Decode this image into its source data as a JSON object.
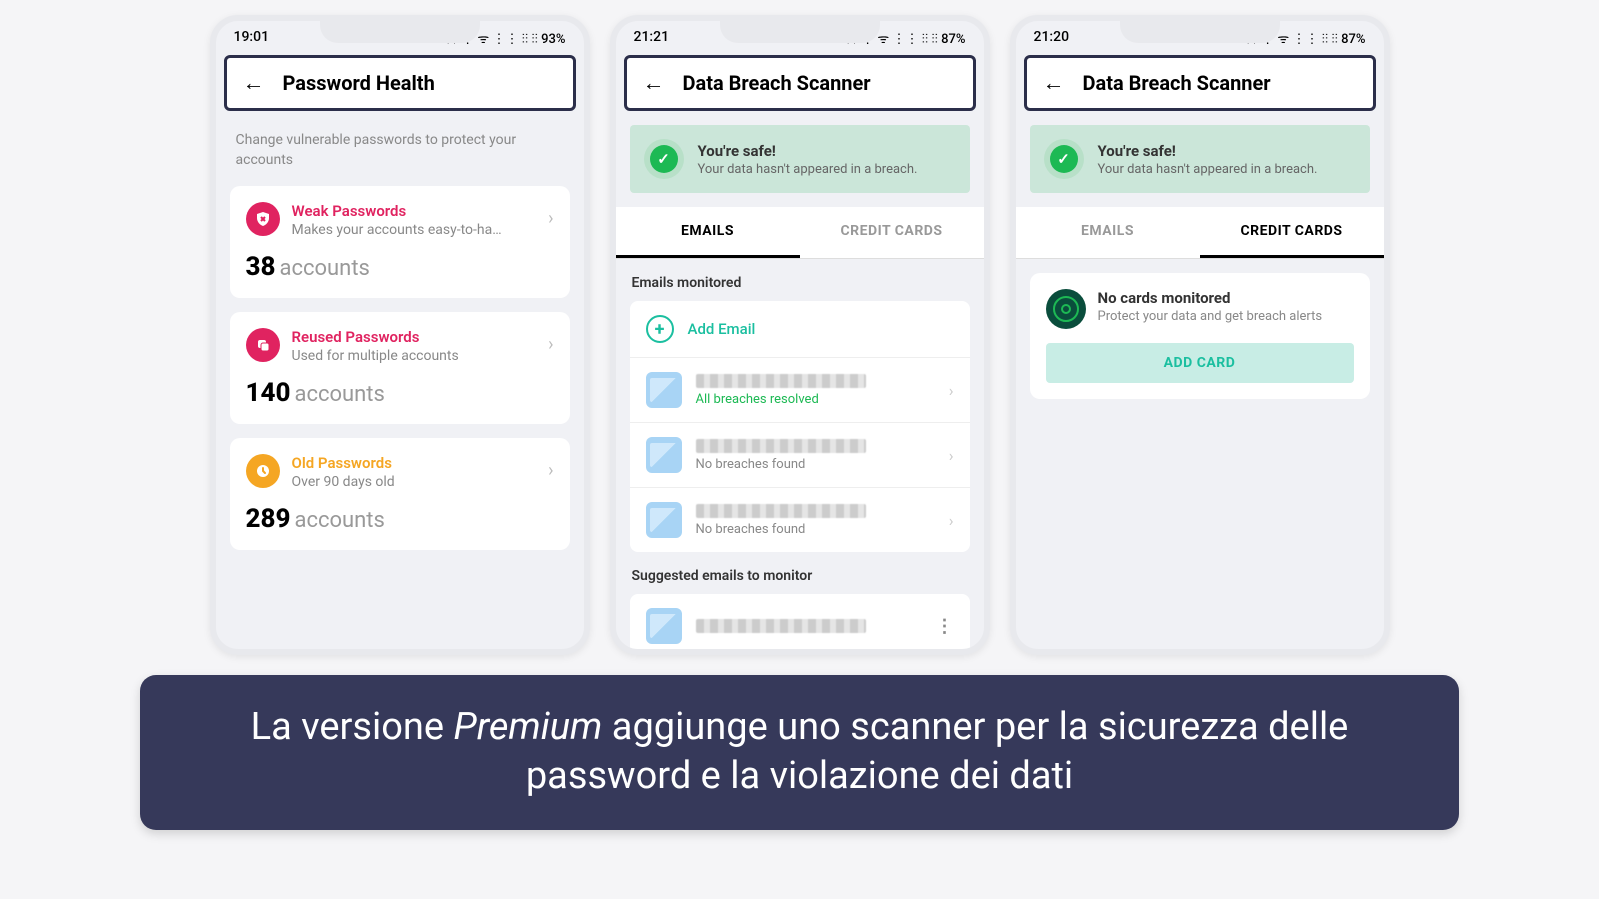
{
  "phone1": {
    "status": {
      "time": "19:01",
      "indicators": "⁂ ⋮ ᯤ ⋮⋮ ⫶⫶ ⫶⫶ 93%"
    },
    "header_title": "Password Health",
    "subtitle": "Change vulnerable passwords to protect your accounts",
    "cards": [
      {
        "title": "Weak Passwords",
        "sub": "Makes your accounts easy-to-ha…",
        "count": "38",
        "count_label": "accounts"
      },
      {
        "title": "Reused Passwords",
        "sub": "Used for multiple accounts",
        "count": "140",
        "count_label": "accounts"
      },
      {
        "title": "Old Passwords",
        "sub": "Over 90 days old",
        "count": "289",
        "count_label": "accounts"
      }
    ]
  },
  "phone2": {
    "status": {
      "time": "21:21",
      "indicators": "⁂ ⋮ ᯤ ⋮⋮ ⫶⫶ ⫶⫶ 87%"
    },
    "header_title": "Data Breach Scanner",
    "safe": {
      "title": "You're safe!",
      "sub": "Your data hasn't appeared in a breach."
    },
    "tabs": {
      "emails": "EMAILS",
      "cards": "CREDIT CARDS"
    },
    "section1": "Emails monitored",
    "add_email": "Add Email",
    "items": [
      {
        "sub": "All breaches resolved"
      },
      {
        "sub": "No breaches found"
      },
      {
        "sub": "No breaches found"
      }
    ],
    "section2": "Suggested emails to monitor"
  },
  "phone3": {
    "status": {
      "time": "21:20",
      "indicators": "⁂ ⋮ ᯤ ⋮⋮ ⫶⫶ ⫶⫶ 87%"
    },
    "header_title": "Data Breach Scanner",
    "safe": {
      "title": "You're safe!",
      "sub": "Your data hasn't appeared in a breach."
    },
    "tabs": {
      "emails": "EMAILS",
      "cards": "CREDIT CARDS"
    },
    "nocards": {
      "title": "No cards monitored",
      "sub": "Protect your data and get breach alerts",
      "button": "ADD CARD"
    }
  },
  "caption": {
    "prefix": "La versione ",
    "italic": "Premium",
    "suffix": " aggiunge uno scanner per la sicurezza delle password e la violazione dei dati"
  }
}
